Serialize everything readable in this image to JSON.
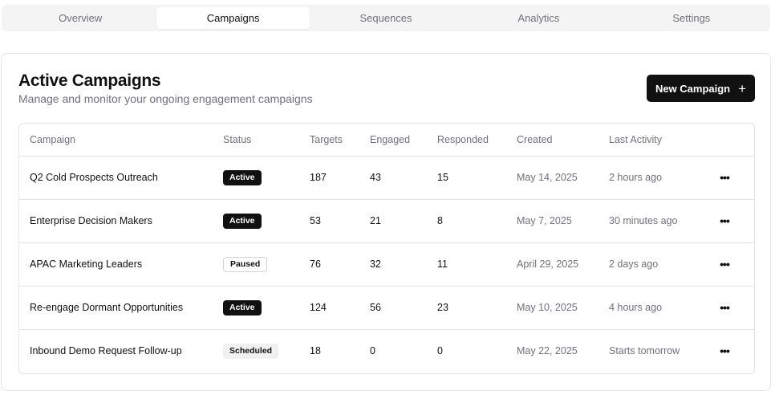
{
  "tabs": [
    {
      "label": "Overview",
      "active": false
    },
    {
      "label": "Campaigns",
      "active": true
    },
    {
      "label": "Sequences",
      "active": false
    },
    {
      "label": "Analytics",
      "active": false
    },
    {
      "label": "Settings",
      "active": false
    }
  ],
  "card": {
    "title": "Active Campaigns",
    "subtitle": "Manage and monitor your ongoing engagement campaigns",
    "new_button_label": "New Campaign",
    "new_button_icon": "plus-icon"
  },
  "table": {
    "columns": [
      "Campaign",
      "Status",
      "Targets",
      "Engaged",
      "Responded",
      "Created",
      "Last Activity"
    ],
    "rows": [
      {
        "campaign": "Q2 Cold Prospects Outreach",
        "status": "Active",
        "targets": "187",
        "engaged": "43",
        "responded": "15",
        "created": "May 14, 2025",
        "last_activity": "2 hours ago"
      },
      {
        "campaign": "Enterprise Decision Makers",
        "status": "Active",
        "targets": "53",
        "engaged": "21",
        "responded": "8",
        "created": "May 7, 2025",
        "last_activity": "30 minutes ago"
      },
      {
        "campaign": "APAC Marketing Leaders",
        "status": "Paused",
        "targets": "76",
        "engaged": "32",
        "responded": "11",
        "created": "April 29, 2025",
        "last_activity": "2 days ago"
      },
      {
        "campaign": "Re-engage Dormant Opportunities",
        "status": "Active",
        "targets": "124",
        "engaged": "56",
        "responded": "23",
        "created": "May 10, 2025",
        "last_activity": "4 hours ago"
      },
      {
        "campaign": "Inbound Demo Request Follow-up",
        "status": "Scheduled",
        "targets": "18",
        "engaged": "0",
        "responded": "0",
        "created": "May 22, 2025",
        "last_activity": "Starts tomorrow"
      }
    ],
    "row_action_icon": "more-horizontal-icon",
    "row_action_glyph": "•••"
  },
  "colors": {
    "primary": "#111111",
    "muted_text": "#71717a",
    "border": "#e4e4e7",
    "tab_bg": "#f4f4f5"
  }
}
